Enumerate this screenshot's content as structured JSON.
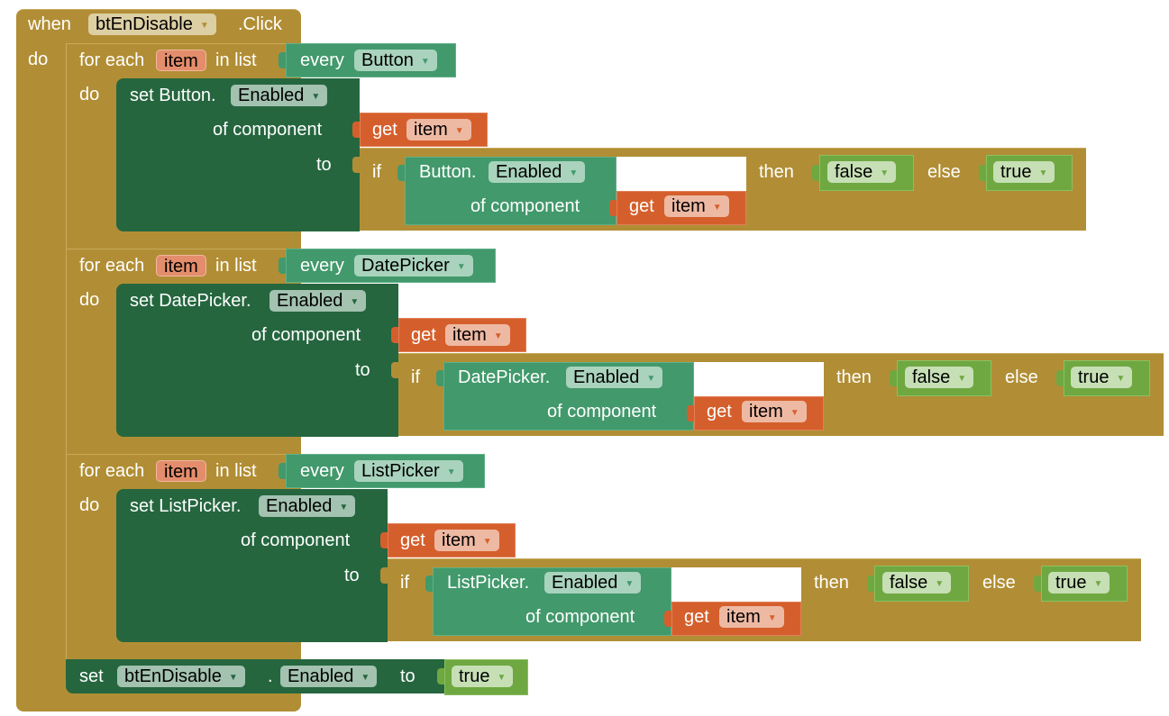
{
  "event": {
    "keyword_when": "when",
    "component": "btEnDisable",
    "event_name": ".Click",
    "keyword_do": "do"
  },
  "loops": [
    {
      "for_each": "for each",
      "var": "item",
      "in_list": "in list",
      "every": "every",
      "component_type": "Button",
      "do": "do",
      "set": "set Button.",
      "property": "Enabled",
      "of_component": "of component",
      "get": "get",
      "get_var": "item",
      "to": "to",
      "if": "if",
      "cond_getter": "Button.",
      "cond_property": "Enabled",
      "cond_of_component": "of component",
      "cond_get": "get",
      "cond_get_var": "item",
      "then": "then",
      "then_value": "false",
      "else": "else",
      "else_value": "true"
    },
    {
      "for_each": "for each",
      "var": "item",
      "in_list": "in list",
      "every": "every",
      "component_type": "DatePicker",
      "do": "do",
      "set": "set DatePicker.",
      "property": "Enabled",
      "of_component": "of component",
      "get": "get",
      "get_var": "item",
      "to": "to",
      "if": "if",
      "cond_getter": "DatePicker.",
      "cond_property": "Enabled",
      "cond_of_component": "of component",
      "cond_get": "get",
      "cond_get_var": "item",
      "then": "then",
      "then_value": "false",
      "else": "else",
      "else_value": "true"
    },
    {
      "for_each": "for each",
      "var": "item",
      "in_list": "in list",
      "every": "every",
      "component_type": "ListPicker",
      "do": "do",
      "set": "set ListPicker.",
      "property": "Enabled",
      "of_component": "of component",
      "get": "get",
      "get_var": "item",
      "to": "to",
      "if": "if",
      "cond_getter": "ListPicker.",
      "cond_property": "Enabled",
      "cond_of_component": "of component",
      "cond_get": "get",
      "cond_get_var": "item",
      "then": "then",
      "then_value": "false",
      "else": "else",
      "else_value": "true"
    }
  ],
  "final_set": {
    "set": "set",
    "component": "btEnDisable",
    "dot": ".",
    "property": "Enabled",
    "to": "to",
    "value": "true"
  },
  "colors": {
    "control": "#b18e35",
    "component_setter": "#25663f",
    "component_getter": "#42996c",
    "variable": "#d55f2c",
    "logic": "#6fa841"
  }
}
